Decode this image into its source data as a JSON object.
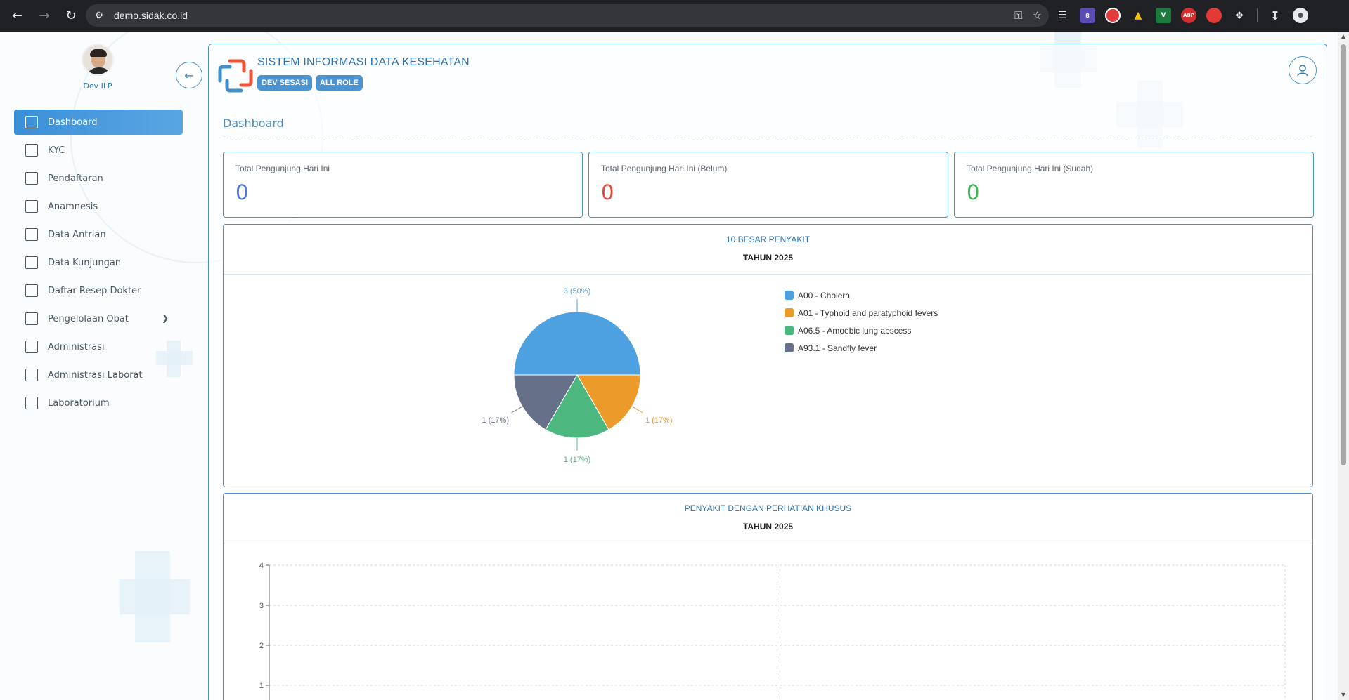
{
  "browser": {
    "url": "demo.sidak.co.id",
    "extension_badge": "8",
    "abp_label": "ABP"
  },
  "sidebar": {
    "user_name": "Dev ILP",
    "items": [
      {
        "label": "Dashboard",
        "icon": "grid-icon",
        "active": true
      },
      {
        "label": "KYC",
        "icon": "file-icon"
      },
      {
        "label": "Pendaftaran",
        "icon": "form-icon"
      },
      {
        "label": "Anamnesis",
        "icon": "list-doc-icon"
      },
      {
        "label": "Data Antrian",
        "icon": "queue-icon"
      },
      {
        "label": "Data Kunjungan",
        "icon": "visits-icon"
      },
      {
        "label": "Daftar Resep Dokter",
        "icon": "prescription-icon"
      },
      {
        "label": "Pengelolaan Obat",
        "icon": "medicine-icon",
        "has_submenu": true
      },
      {
        "label": "Administrasi",
        "icon": "admin-icon"
      },
      {
        "label": "Administrasi Laborat",
        "icon": "lab-admin-icon"
      },
      {
        "label": "Laboratorium",
        "icon": "lab-icon"
      }
    ]
  },
  "header": {
    "title": "SISTEM INFORMASI DATA KESEHATAN",
    "badges": [
      "DEV SESASI",
      "ALL ROLE"
    ]
  },
  "breadcrumb": "Dashboard",
  "stats": [
    {
      "label": "Total Pengunjung Hari Ini",
      "value": "0",
      "color": "#4a78d6"
    },
    {
      "label": "Total Pengunjung Hari Ini (Belum)",
      "value": "0",
      "color": "#e0493b"
    },
    {
      "label": "Total Pengunjung Hari Ini (Sudah)",
      "value": "0",
      "color": "#3fb34f"
    }
  ],
  "chart_data": [
    {
      "type": "pie",
      "title": "10 BESAR PENYAKIT",
      "subtitle": "TAHUN 2025",
      "labels": [
        "A00 - Cholera",
        "A01 - Typhoid and paratyphoid fevers",
        "A06.5 - Amoebic lung abscess",
        "A93.1 - Sandfly fever"
      ],
      "values": [
        3,
        1,
        1,
        1
      ],
      "slice_labels": [
        "3 (50%)",
        "1 (17%)",
        "1 (17%)",
        "1 (17%)"
      ],
      "colors": [
        "#4ea1e0",
        "#ec9a2a",
        "#4cb87f",
        "#677089"
      ],
      "legend": "right"
    },
    {
      "type": "line",
      "title": "PENYAKIT DENGAN PERHATIAN KHUSUS",
      "subtitle": "TAHUN 2025",
      "y_ticks": [
        "4",
        "3",
        "2",
        "1"
      ],
      "ylim": [
        0,
        4
      ],
      "grid": true
    }
  ]
}
